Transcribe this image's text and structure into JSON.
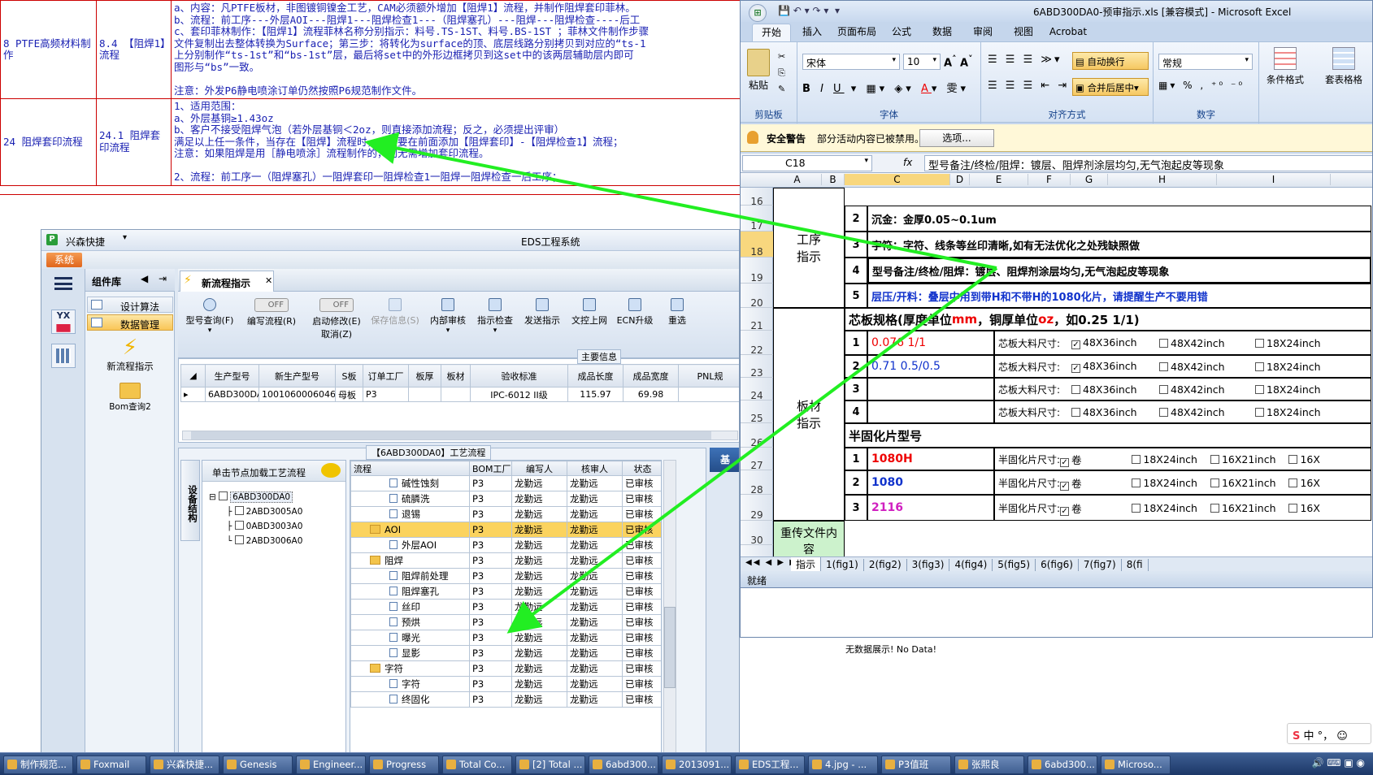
{
  "doc": {
    "rows": [
      {
        "c1": "8 PTFE高频材料制作",
        "c2": "8.4 【阻焊1】流程",
        "lines": [
          "a、内容：凡PTFE板材，非图镀铜镍金工艺，CAM必须额外增加【阻焊1】流程，并制作阻焊套印菲林。",
          "b、流程：前工序---外层AOI---阻焊1---阻焊检查1---（阻焊塞孔）---阻焊---阻焊检查----后工",
          "c、套印菲林制作：【阻焊1】流程菲林名称分别指示：料号.TS-1ST、料号.BS-1ST ；菲林文件制作步骤",
          "文件复制出去整体转换为Surface；第三步：将转化为surface的顶、底层线路分别拷贝到对应的“ts-1",
          "上分别制作“ts-1st”和“bs-1st”层，最后将set中的外形边框拷贝到这set中的该两层辅助层内即可",
          "图形与“bs”一致。",
          "",
          "注意：外发P6静电喷涂订单仍然按照P6规范制作文件。"
        ]
      },
      {
        "c1": "24 阻焊套印流程",
        "c2": "24.1 阻焊套印流程",
        "lines": [
          "1、适用范围：",
          "  a、外层基铜≥1.43oz",
          "  b、客户不接受阻焊气泡（若外层基铜＜2oz，则直接添加流程；反之，必须提出评审）",
          "  满足以上任一条件，当存在【阻焊】流程时，一定要在前面添加【阻焊套印】-【阻焊检查1】流程；",
          "注意：如果阻焊是用［静电喷涂］流程制作的，则无需增加套印流程。",
          "",
          "2、流程：前工序一（阻焊塞孔）一阻焊套印一阻焊检查1一阻焊一阻焊检查一后工序；"
        ]
      }
    ]
  },
  "eds": {
    "app_name": "兴森快捷",
    "title": "EDS工程系统",
    "menu_system": "系统",
    "panel_title": "组件库",
    "nav": [
      "设计算法",
      "数据管理"
    ],
    "tiles": [
      "新流程指示",
      "Bom查询2"
    ],
    "tab": "新流程指示",
    "toolbar": [
      "型号查询(F)",
      "编写流程(R)",
      "启动修改(E)",
      "保存信息(S)",
      "内部审核",
      "指示检查",
      "发送指示",
      "文控上网",
      "ECN升级",
      "重选"
    ],
    "toolbar_sub": "取消(Z)",
    "off": "OFF",
    "main_info": "主要信息",
    "grid_headers": [
      "生产型号",
      "新生产型号",
      "S板",
      "订单工厂",
      "板厚",
      "板材",
      "验收标准",
      "成品长度",
      "成品宽度",
      "PNL规"
    ],
    "grid_row": [
      "6ABD300DA0",
      "10010600060469",
      "母板",
      "P3",
      "",
      "",
      "IPC-6012 II级",
      "115.97",
      "69.98",
      ""
    ],
    "flow_title": "【6ABD300DA0】工艺流程",
    "side_tab": "设备结构",
    "node_hint": "单击节点加载工艺流程",
    "tree": [
      "6ABD300DA0",
      "2ABD3005A0",
      "0ABD3003A0",
      "2ABD3006A0"
    ],
    "flow_headers": [
      "流程",
      "BOM工厂",
      "编写人",
      "核审人",
      "状态"
    ],
    "flow_rows": [
      {
        "name": "碱性蚀刻",
        "f": "P3",
        "w": "龙勤远",
        "h": "龙勤远",
        "s": "已审核",
        "lv": 2
      },
      {
        "name": "硫膦洗",
        "f": "P3",
        "w": "龙勤远",
        "h": "龙勤远",
        "s": "已审核",
        "lv": 2
      },
      {
        "name": "退锡",
        "f": "P3",
        "w": "龙勤远",
        "h": "龙勤远",
        "s": "已审核",
        "lv": 2
      },
      {
        "name": "AOI",
        "f": "P3",
        "w": "龙勤远",
        "h": "龙勤远",
        "s": "已审核",
        "lv": 1,
        "sel": true
      },
      {
        "name": "外层AOI",
        "f": "P3",
        "w": "龙勤远",
        "h": "龙勤远",
        "s": "已审核",
        "lv": 2
      },
      {
        "name": "阻焊",
        "f": "P3",
        "w": "龙勤远",
        "h": "龙勤远",
        "s": "已审核",
        "lv": 1
      },
      {
        "name": "阻焊前处理",
        "f": "P3",
        "w": "龙勤远",
        "h": "龙勤远",
        "s": "已审核",
        "lv": 2
      },
      {
        "name": "阻焊塞孔",
        "f": "P3",
        "w": "龙勤远",
        "h": "龙勤远",
        "s": "已审核",
        "lv": 2
      },
      {
        "name": "丝印",
        "f": "P3",
        "w": "龙勤远",
        "h": "龙勤远",
        "s": "已审核",
        "lv": 2
      },
      {
        "name": "预烘",
        "f": "P3",
        "w": "龙勤远",
        "h": "龙勤远",
        "s": "已审核",
        "lv": 2
      },
      {
        "name": "曝光",
        "f": "P3",
        "w": "龙勤远",
        "h": "龙勤远",
        "s": "已审核",
        "lv": 2
      },
      {
        "name": "显影",
        "f": "P3",
        "w": "龙勤远",
        "h": "龙勤远",
        "s": "已审核",
        "lv": 2
      },
      {
        "name": "字符",
        "f": "P3",
        "w": "龙勤远",
        "h": "龙勤远",
        "s": "已审核",
        "lv": 1
      },
      {
        "name": "字符",
        "f": "P3",
        "w": "龙勤远",
        "h": "龙勤远",
        "s": "已审核",
        "lv": 2
      },
      {
        "name": "终固化",
        "f": "P3",
        "w": "龙勤远",
        "h": "龙勤远",
        "s": "已审核",
        "lv": 2
      }
    ],
    "right_tab": "基"
  },
  "no_data": "无数据展示! No Data!",
  "excel": {
    "title": "6ABD300DA0-预审指示.xls  [兼容模式] - Microsoft Excel",
    "tabs": [
      "开始",
      "插入",
      "页面布局",
      "公式",
      "数据",
      "审阅",
      "视图",
      "Acrobat"
    ],
    "font_name": "宋体",
    "font_size": "10",
    "number_format": "常规",
    "wrap": "自动换行",
    "merge": "合并后居中",
    "paste": "粘贴",
    "cond": "条件格式",
    "table_fmt": "套表格格",
    "group_labels": [
      "剪贴板",
      "字体",
      "对齐方式",
      "数字"
    ],
    "security_label": "安全警告",
    "security_text": "部分活动内容已被禁用。",
    "options": "选项...",
    "name_box": "C18",
    "fx": "fx",
    "formula": "型号备注/终检/阻焊：镀层、阻焊剂涂层均匀,无气泡起皮等现象",
    "cols": [
      "A",
      "B",
      "C",
      "D",
      "E",
      "F",
      "G",
      "H",
      "I"
    ],
    "row_nums": [
      "16",
      "17",
      "18",
      "19",
      "20",
      "21",
      "22",
      "23",
      "24",
      "25",
      "26",
      "27",
      "28",
      "29",
      "30"
    ],
    "section_gx": "工序指示",
    "section_bc": "板材指示",
    "section_up": "重传文件内容",
    "gx_rows": [
      {
        "n": "2",
        "t": "沉金：金厚0.05~0.1um"
      },
      {
        "n": "3",
        "t": "字符：字符、线条等丝印清晰,如有无法优化之处残缺照做"
      },
      {
        "n": "4",
        "t": "型号备注/终检/阻焊：镀层、阻焊剂涂层均匀,无气泡起皮等现象"
      },
      {
        "n": "5",
        "t": "层压/开料：叠层中用到带H和不带H的1080化片，请提醒生产不要用错"
      }
    ],
    "core_title": "芯板规格(厚度单位",
    "core_mm": "mm",
    "core_mid": "，铜厚单位",
    "core_oz": "oz",
    "core_ex": "，如0.25 1/1)",
    "core_rows": [
      {
        "n": "1",
        "v": "0.076 1/1",
        "c": "#e00"
      },
      {
        "n": "2",
        "v": "0.71 0.5/0.5",
        "c": "#1133cc"
      },
      {
        "n": "3",
        "v": "",
        "c": "#000"
      },
      {
        "n": "4",
        "v": "",
        "c": "#000"
      }
    ],
    "core_label": "芯板大料尺寸:",
    "core_sizes": [
      "48X36inch",
      "48X42inch",
      "18X24inch"
    ],
    "pp_title": "半固化片型号",
    "pp_rows": [
      {
        "n": "1",
        "v": "1080H",
        "c": "#e00"
      },
      {
        "n": "2",
        "v": "1080",
        "c": "#1133cc"
      },
      {
        "n": "3",
        "v": "2116",
        "c": "#d020c0"
      }
    ],
    "pp_label": "半固化片尺寸:",
    "pp_sizes": [
      "卷",
      "18X24inch",
      "16X21inch",
      "16X"
    ],
    "sheet_tabs": [
      "指示",
      "1(fig1)",
      "2(fig2)",
      "3(fig3)",
      "4(fig4)",
      "5(fig5)",
      "6(fig6)",
      "7(fig7)",
      "8(fi"
    ],
    "status": "就绪"
  },
  "taskbar": [
    "制作规范...",
    "Foxmail",
    "兴森快捷...",
    "Genesis",
    "Engineer...",
    "Progress",
    "Total Co...",
    "[2] Total ...",
    "6abd300...",
    "2013091...",
    "EDS工程...",
    "4.jpg - ...",
    "P3值班",
    "张熙良",
    "6abd300...",
    "Microso..."
  ],
  "tray": {
    "ime": "中",
    "clock": ""
  },
  "colors": {
    "arrow": "#22ee22",
    "doc_text": "#1b22b3",
    "doc_border": "#cc0000"
  }
}
